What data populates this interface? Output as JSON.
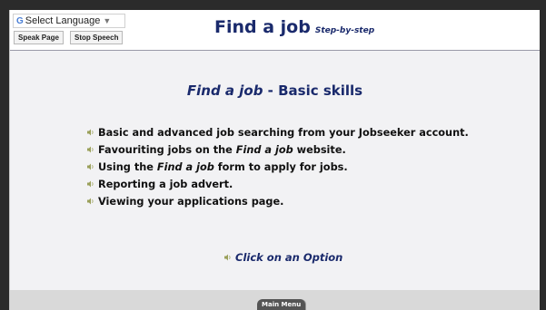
{
  "header": {
    "language_label": "Select Language",
    "language_g": "G",
    "speak_page": "Speak Page",
    "stop_speech": "Stop Speech",
    "title": "Find a job",
    "subtitle": "Step-by-step"
  },
  "main": {
    "heading_italic": "Find a job",
    "heading_rest": " - Basic skills",
    "items": [
      {
        "before": "Basic and advanced job searching from your Jobseeker account.",
        "em": "",
        "after": ""
      },
      {
        "before": "Favouriting jobs on the ",
        "em": "Find a job",
        "after": " website."
      },
      {
        "before": "Using the ",
        "em": "Find a job",
        "after": " form to apply for jobs."
      },
      {
        "before": "Reporting a job advert.",
        "em": "",
        "after": ""
      },
      {
        "before": "Viewing your applications page.",
        "em": "",
        "after": ""
      }
    ],
    "option_prompt": "Click on an Option"
  },
  "footer": {
    "main_menu": "Main Menu"
  },
  "colors": {
    "title": "#1a2a6c",
    "speaker_icon": "#9aa05a"
  },
  "icons": {
    "speaker": "speaker-icon",
    "dropdown": "dropdown-arrow-icon"
  }
}
